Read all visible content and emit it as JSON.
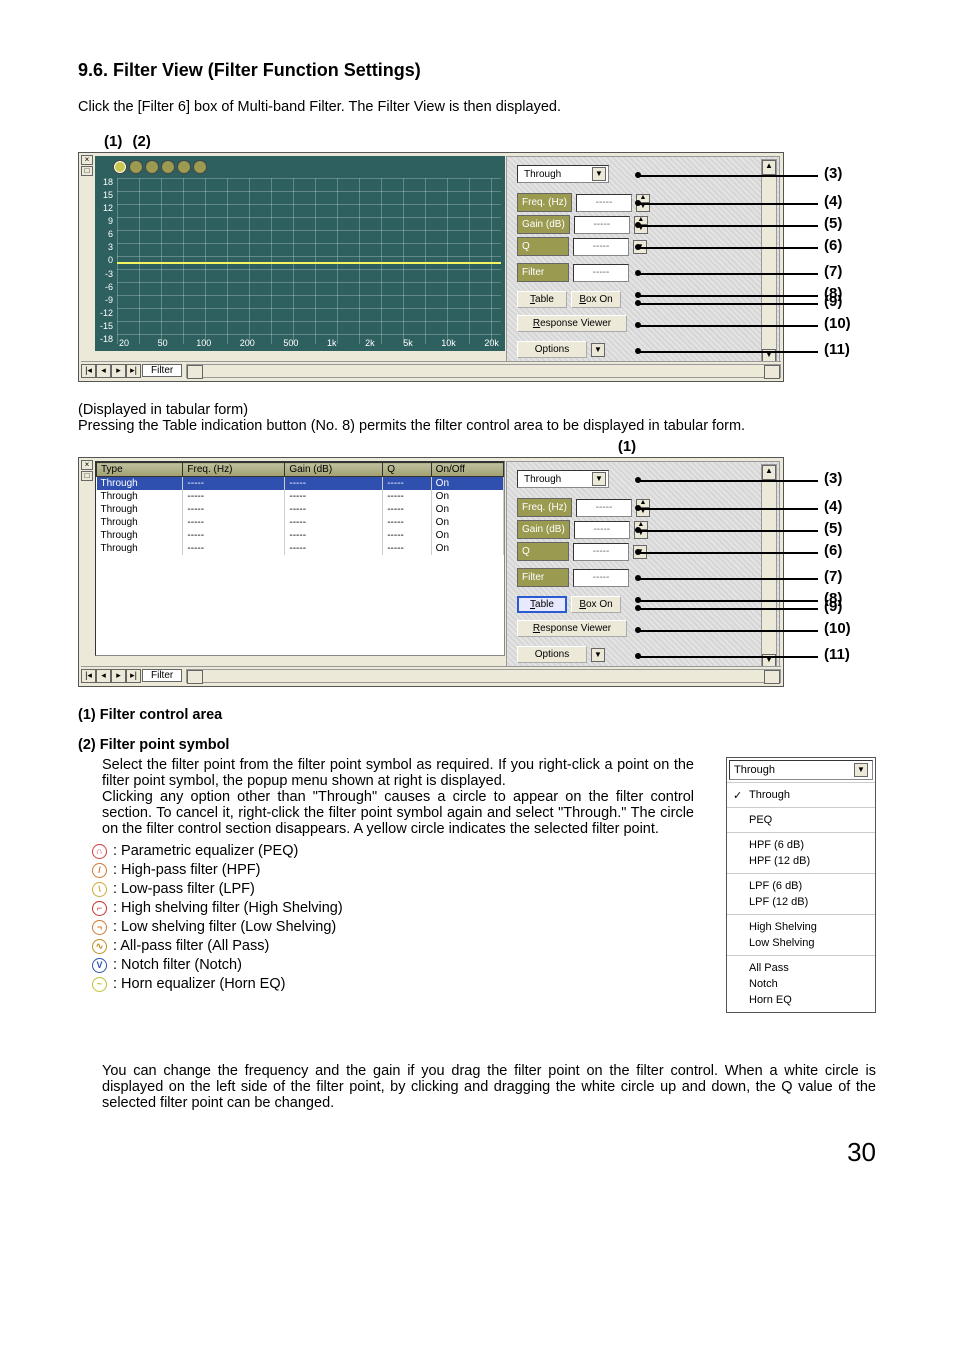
{
  "page_number": "30",
  "section": {
    "number": "9.6.",
    "title": "Filter View (Filter Function Settings)",
    "intro": "Click the [Filter 6] box of Multi-band Filter. The Filter View is then displayed."
  },
  "fig1": {
    "hdr_1": "(1)",
    "hdr_2": "(2)",
    "y_ticks": [
      "18",
      "15",
      "12",
      "9",
      "6",
      "3",
      "0",
      "-3",
      "-6",
      "-9",
      "-12",
      "-15",
      "-18"
    ],
    "x_ticks": [
      "20",
      "50",
      "100",
      "200",
      "500",
      "1k",
      "2k",
      "5k",
      "10k",
      "20k"
    ],
    "tab_name": "Filter"
  },
  "fig2": {
    "title": "(Displayed in tabular form)",
    "desc": "Pressing the Table indication button (No. 8) permits the filter control area to be displayed in tabular form.",
    "hdr_1": "(1)",
    "headers": [
      "Type",
      "Freq. (Hz)",
      "Gain (dB)",
      "Q",
      "On/Off"
    ],
    "rows": [
      {
        "type": "Through",
        "freq": "-----",
        "gain": "-----",
        "q": "-----",
        "on": "On",
        "sel": true
      },
      {
        "type": "Through",
        "freq": "-----",
        "gain": "-----",
        "q": "-----",
        "on": "On"
      },
      {
        "type": "Through",
        "freq": "-----",
        "gain": "-----",
        "q": "-----",
        "on": "On"
      },
      {
        "type": "Through",
        "freq": "-----",
        "gain": "-----",
        "q": "-----",
        "on": "On"
      },
      {
        "type": "Through",
        "freq": "-----",
        "gain": "-----",
        "q": "-----",
        "on": "On"
      },
      {
        "type": "Through",
        "freq": "-----",
        "gain": "-----",
        "q": "-----",
        "on": "On"
      }
    ]
  },
  "panel": {
    "type_value": "Through",
    "freq_label": "Freq. (Hz)",
    "freq_value": "-----",
    "gain_label": "Gain (dB)",
    "gain_value": "-----",
    "q_label": "Q",
    "q_value": "-----",
    "filter_label": "Filter",
    "filter_value": "-----",
    "table_btn": "Table",
    "box_btn": "Box On",
    "response_btn": "Response Viewer",
    "options_btn": "Options"
  },
  "callouts": {
    "c3": "(3)",
    "c4": "(4)",
    "c5": "(5)",
    "c6": "(6)",
    "c7": "(7)",
    "c8": "(8)",
    "c9": "(9)",
    "c10": "(10)",
    "c11": "(11)"
  },
  "item1": {
    "heading": "(1) Filter control area"
  },
  "item2": {
    "heading": "(2) Filter point symbol",
    "p1": "Select the filter point from the filter point symbol as required. If you right-click a point on the filter point symbol, the popup menu shown at right is displayed.",
    "p2": "Clicking any option other than \"Through\" causes a circle to appear on the filter control section. To cancel it, right-click the filter point symbol again and select \"Through.\" The circle on the filter control section disappears. A yellow circle indicates the selected filter point.",
    "icons": [
      {
        "color": "#D04040",
        "glyph": "∩",
        "label": ": Parametric equalizer (PEQ)"
      },
      {
        "color": "#D07830",
        "glyph": "/",
        "label": ": High-pass filter (HPF)"
      },
      {
        "color": "#D0A830",
        "glyph": "\\",
        "label": ": Low-pass filter (LPF)"
      },
      {
        "color": "#C83030",
        "glyph": "⌐",
        "label": ": High shelving filter (High Shelving)"
      },
      {
        "color": "#D07830",
        "glyph": "¬",
        "label": ": Low shelving filter (Low Shelving)"
      },
      {
        "color": "#C09020",
        "glyph": "∿",
        "label": ": All-pass filter (All Pass)"
      },
      {
        "color": "#3050B0",
        "glyph": "V",
        "label": ": Notch filter (Notch)"
      },
      {
        "color": "#C0C030",
        "glyph": "~",
        "label": ": Horn equalizer (Horn EQ)"
      }
    ],
    "p3": "You can change the frequency and the gain if you drag the filter point on the filter control. When a white circle is displayed on the left side of the filter point, by clicking and dragging the white circle up and down, the Q value of the selected filter point can be changed."
  },
  "popup": {
    "head": "Through",
    "items": [
      {
        "label": "Through",
        "chk": true,
        "group": 0
      },
      {
        "label": "PEQ",
        "group": 1
      },
      {
        "label": "HPF (6 dB)",
        "group": 2
      },
      {
        "label": "HPF (12 dB)",
        "group": 2
      },
      {
        "label": "LPF (6 dB)",
        "group": 3
      },
      {
        "label": "LPF (12 dB)",
        "group": 3
      },
      {
        "label": "High Shelving",
        "group": 4
      },
      {
        "label": "Low Shelving",
        "group": 4
      },
      {
        "label": "All Pass",
        "group": 5
      },
      {
        "label": "Notch",
        "group": 5
      },
      {
        "label": "Horn EQ",
        "group": 5
      }
    ]
  }
}
